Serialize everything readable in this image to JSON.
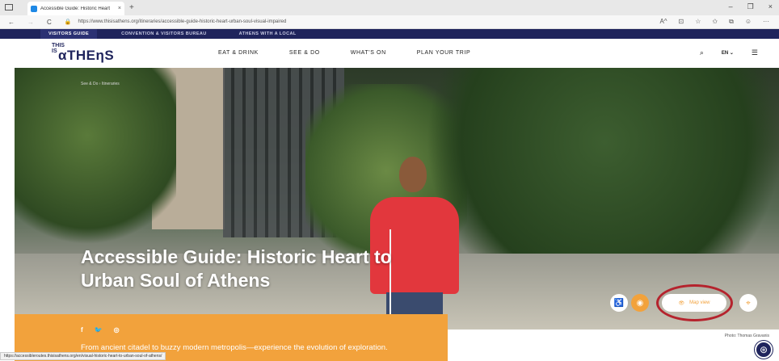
{
  "browser": {
    "tab_title": "Accessible Guide: Historic Heart",
    "tab_close": "×",
    "new_tab": "+",
    "window_controls": [
      "–",
      "❐",
      "×"
    ],
    "url": "https://www.thisisathens.org/itineraries/accessible-guide-historic-heart-urban-soul-visual-impaired",
    "nav": [
      "←",
      "→",
      "C"
    ],
    "toolbar_icons": [
      "A^",
      "⊡",
      "☆",
      "✩",
      "⧉",
      "☺",
      "···"
    ]
  },
  "top_strip": {
    "items": [
      "VISITORS GUIDE",
      "CONVENTION & VISITORS BUREAU",
      "ATHENS WITH A LOCAL"
    ]
  },
  "header": {
    "logo_small": "THIS IS",
    "logo_big": "αTHEηS",
    "links": [
      "EAT & DRINK",
      "SEE & DO",
      "WHAT'S ON",
      "PLAN YOUR TRIP"
    ],
    "lang": "EN ⌄",
    "search_glyph": "⌕",
    "menu_glyph": "☰"
  },
  "hero": {
    "breadcrumb": "See & Do  ›  Itineraries",
    "title": "Accessible Guide: Historic Heart to Urban Soul of Athens",
    "photo_credit": "Photo: Thomas Gravanis"
  },
  "intro": {
    "social": [
      "f",
      "🐦",
      "◎"
    ],
    "description": "From ancient citadel to buzzy modern metropolis—experience the evolution of exploration."
  },
  "controls": {
    "wheelchair_glyph": "♿",
    "eye_glyph": "◉",
    "map_label": "Map view",
    "map_glyph": "👁",
    "pin_glyph": "⌖"
  },
  "status_url": "https://accessibleroutes.thisisathens.org/en/visual-historic-heart-to-urban-soul-of-athens/",
  "accessibility_glyph": "⊛",
  "colors": {
    "navy": "#1f245c",
    "orange": "#f2a23c",
    "highlight_ring": "#b5232d"
  }
}
